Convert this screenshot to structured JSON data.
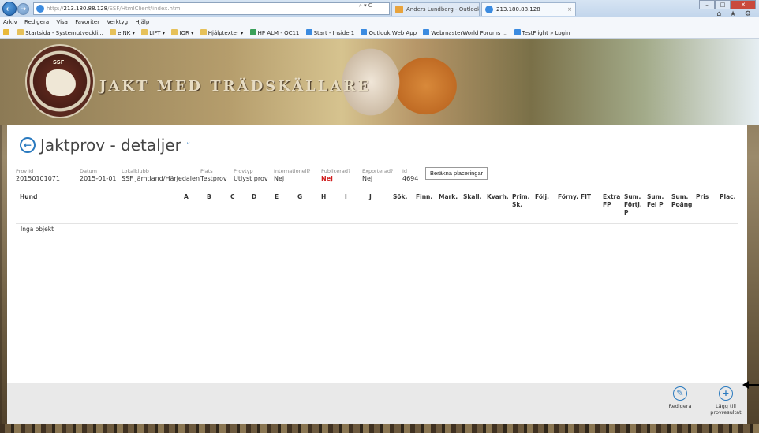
{
  "browser": {
    "address": "http://213.180.88.128/SSF/HtmlClient/index.html",
    "address_host": "213.180.88.128",
    "address_prefix": "http://",
    "address_suffix": "/SSF/HtmlClient/index.html",
    "address_actions": "⌕ ▾ C",
    "tabs": [
      {
        "label": "Anders Lundberg - Outlook W..."
      },
      {
        "label": "213.180.88.128",
        "close": "×"
      }
    ],
    "window_controls": [
      "–",
      "□",
      "✕"
    ],
    "toolbar_icons": "⌂ ★ ⚙"
  },
  "menubar": [
    "Arkiv",
    "Redigera",
    "Visa",
    "Favoriter",
    "Verktyg",
    "Hjälp"
  ],
  "favorites": [
    {
      "label": "Startsida - Systemutveckli...",
      "icon": "fi-folder"
    },
    {
      "label": "eINK ▾",
      "icon": "fi-folder"
    },
    {
      "label": "LIFT ▾",
      "icon": "fi-folder"
    },
    {
      "label": "IOR ▾",
      "icon": "fi-folder"
    },
    {
      "label": "Hjälptexter ▾",
      "icon": "fi-folder"
    },
    {
      "label": "HP ALM - QC11",
      "icon": "fi-green"
    },
    {
      "label": "Start - Inside 1",
      "icon": "fi-page"
    },
    {
      "label": "Outlook Web App",
      "icon": "fi-page"
    },
    {
      "label": "WebmasterWorld Forums ...",
      "icon": "fi-page"
    },
    {
      "label": "TestFlight » Login",
      "icon": "fi-page"
    }
  ],
  "banner": {
    "title": "JAKT MED TRÄDSKÄLLARE",
    "seal_text": "SSF"
  },
  "page": {
    "title": "Jaktprov - detaljer",
    "back_glyph": "←",
    "chevron": "˅"
  },
  "fields": [
    {
      "label": "Prov Id",
      "value": "20150101071"
    },
    {
      "label": "Datum",
      "value": "2015-01-01"
    },
    {
      "label": "Lokalklubb",
      "value": "SSF Jämtland/Härjedalen"
    },
    {
      "label": "Plats",
      "value": "Testprov"
    },
    {
      "label": "Provtyp",
      "value": "Utlyst prov"
    },
    {
      "label": "Internationell?",
      "value": "Nej"
    },
    {
      "label": "Publicerad?",
      "value": "Nej",
      "highlight": true
    },
    {
      "label": "Exporterad?",
      "value": "Nej"
    },
    {
      "label": "Id",
      "value": "4694"
    }
  ],
  "calc_button": "Beräkna placeringar",
  "columns": [
    "Hund",
    "A",
    "B",
    "C",
    "D",
    "E",
    "G",
    "H",
    "I",
    "J",
    "Sök.",
    "Finn.",
    "Mark.",
    "Skall.",
    "Kvarh.",
    "Prim. Sk.",
    "Följ.",
    "Förny.",
    "FIT",
    "Extra FP",
    "Sum. Förtj. P",
    "Sum. Fel P",
    "Sum. Poäng",
    "Pris",
    "Plac."
  ],
  "empty_message": "Inga objekt",
  "commands": {
    "edit_label": "Redigera",
    "edit_icon": "pencil-circle",
    "add_label": "Lägg till provresultat",
    "add_icon": "plus-circle"
  },
  "colors": {
    "accent": "#2a7abf",
    "highlight_red": "#d02020"
  }
}
